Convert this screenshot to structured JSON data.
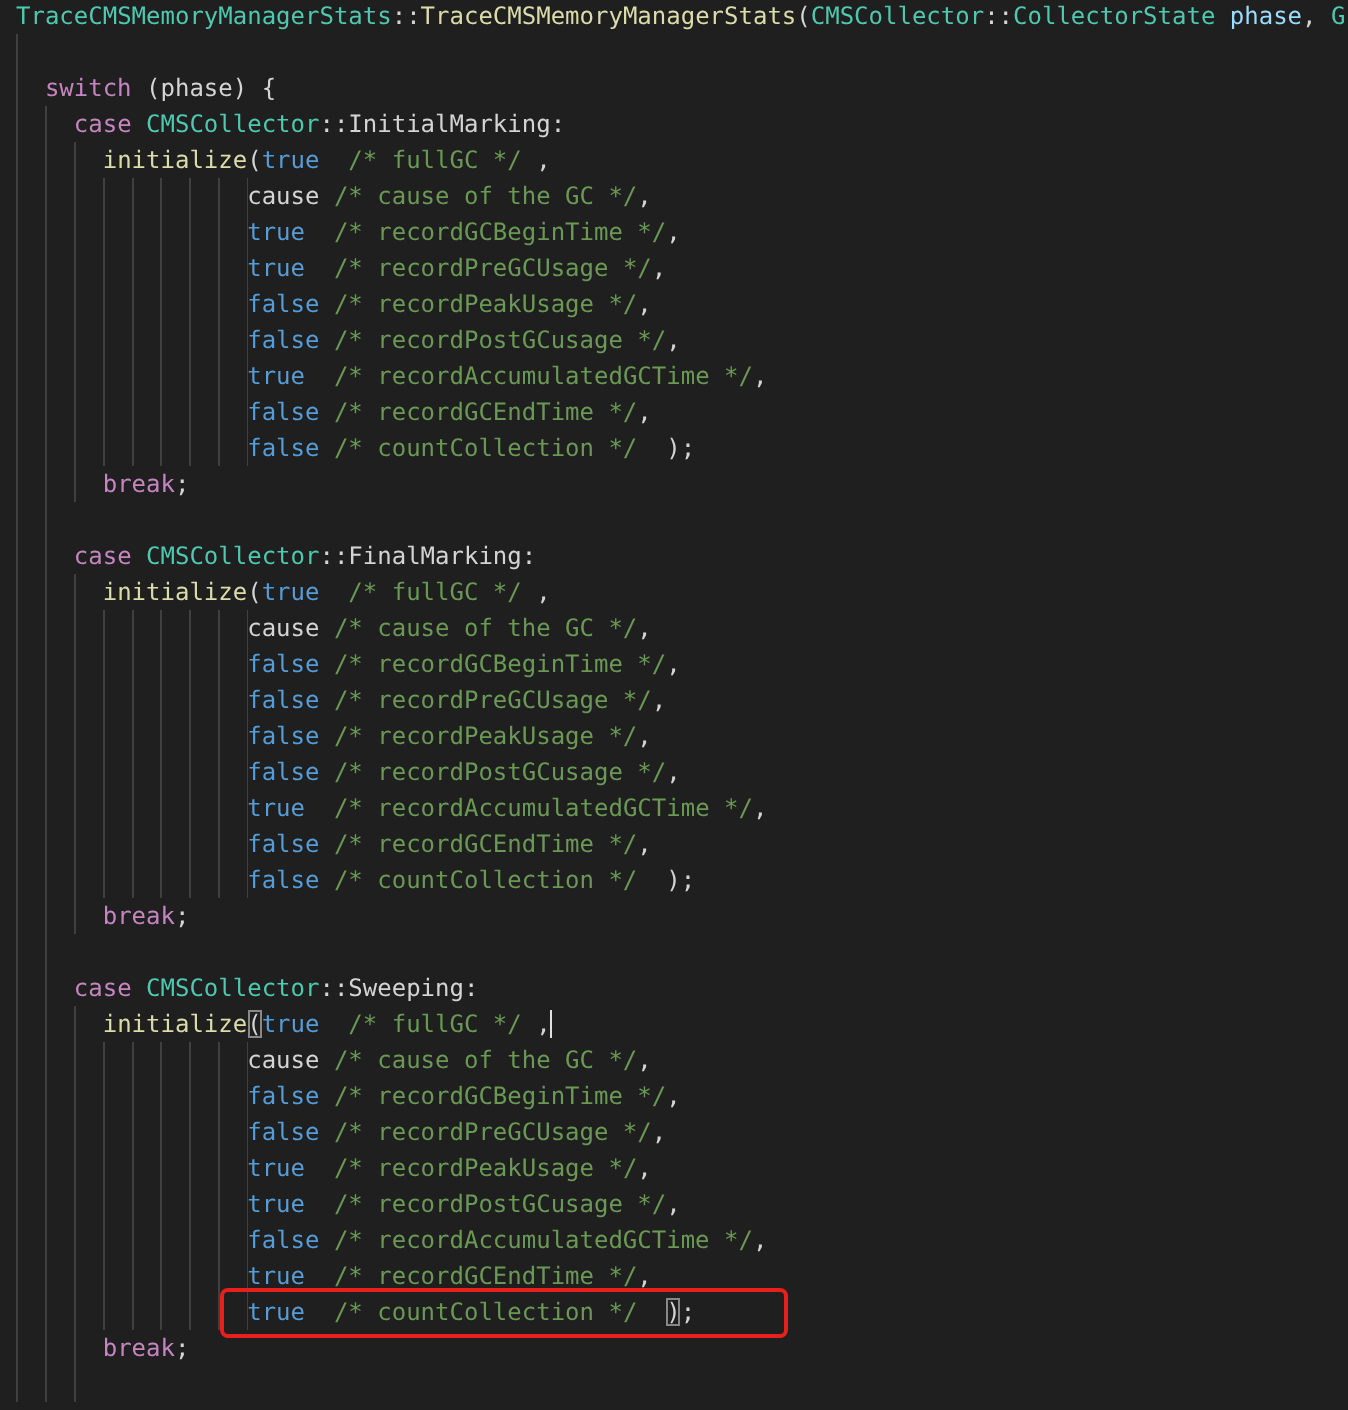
{
  "editor": {
    "lines": [
      {
        "kind": "code",
        "tokens": [
          {
            "kind": "type",
            "text": "TraceCMSMemoryManagerStats"
          },
          {
            "kind": "plain",
            "text": "::"
          },
          {
            "kind": "function",
            "text": "TraceCMSMemoryManagerStats"
          },
          {
            "kind": "plain",
            "text": "("
          },
          {
            "kind": "type",
            "text": "CMSCollector"
          },
          {
            "kind": "plain",
            "text": "::"
          },
          {
            "kind": "type",
            "text": "CollectorState"
          },
          {
            "kind": "param",
            "text": " phase"
          },
          {
            "kind": "plain",
            "text": ", "
          },
          {
            "kind": "type",
            "text": "G"
          }
        ]
      },
      {
        "kind": "blank"
      },
      {
        "kind": "code",
        "tokens": [
          {
            "kind": "keyword",
            "text": "  switch"
          },
          {
            "kind": "plain",
            "text": " (phase) {"
          }
        ]
      },
      {
        "kind": "code",
        "tokens": [
          {
            "kind": "keyword",
            "text": "    case "
          },
          {
            "kind": "type",
            "text": "CMSCollector"
          },
          {
            "kind": "plain",
            "text": "::InitialMarking:"
          }
        ]
      },
      {
        "kind": "code",
        "tokens": [
          {
            "kind": "function",
            "text": "      initialize"
          },
          {
            "kind": "plain",
            "text": "("
          },
          {
            "kind": "constant",
            "text": "true"
          },
          {
            "kind": "comment",
            "text": "  /* fullGC */"
          },
          {
            "kind": "plain",
            "text": " ,"
          }
        ]
      },
      {
        "kind": "code",
        "tokens": [
          {
            "kind": "plain",
            "text": "                cause"
          },
          {
            "kind": "comment",
            "text": " /* cause of the GC */"
          },
          {
            "kind": "plain",
            "text": ","
          }
        ]
      },
      {
        "kind": "code",
        "tokens": [
          {
            "kind": "constant",
            "text": "                true"
          },
          {
            "kind": "comment",
            "text": "  /* recordGCBeginTime */"
          },
          {
            "kind": "plain",
            "text": ","
          }
        ]
      },
      {
        "kind": "code",
        "tokens": [
          {
            "kind": "constant",
            "text": "                true"
          },
          {
            "kind": "comment",
            "text": "  /* recordPreGCUsage */"
          },
          {
            "kind": "plain",
            "text": ","
          }
        ]
      },
      {
        "kind": "code",
        "tokens": [
          {
            "kind": "constant",
            "text": "                false"
          },
          {
            "kind": "comment",
            "text": " /* recordPeakUsage */"
          },
          {
            "kind": "plain",
            "text": ","
          }
        ]
      },
      {
        "kind": "code",
        "tokens": [
          {
            "kind": "constant",
            "text": "                false"
          },
          {
            "kind": "comment",
            "text": " /* recordPostGCusage */"
          },
          {
            "kind": "plain",
            "text": ","
          }
        ]
      },
      {
        "kind": "code",
        "tokens": [
          {
            "kind": "constant",
            "text": "                true"
          },
          {
            "kind": "comment",
            "text": "  /* recordAccumulatedGCTime */"
          },
          {
            "kind": "plain",
            "text": ","
          }
        ]
      },
      {
        "kind": "code",
        "tokens": [
          {
            "kind": "constant",
            "text": "                false"
          },
          {
            "kind": "comment",
            "text": " /* recordGCEndTime */"
          },
          {
            "kind": "plain",
            "text": ","
          }
        ]
      },
      {
        "kind": "code",
        "tokens": [
          {
            "kind": "constant",
            "text": "                false"
          },
          {
            "kind": "comment",
            "text": " /* countCollection */"
          },
          {
            "kind": "plain",
            "text": "  );"
          }
        ]
      },
      {
        "kind": "code",
        "tokens": [
          {
            "kind": "keyword",
            "text": "      break"
          },
          {
            "kind": "plain",
            "text": ";"
          }
        ]
      },
      {
        "kind": "blank"
      },
      {
        "kind": "code",
        "tokens": [
          {
            "kind": "keyword",
            "text": "    case "
          },
          {
            "kind": "type",
            "text": "CMSCollector"
          },
          {
            "kind": "plain",
            "text": "::FinalMarking:"
          }
        ]
      },
      {
        "kind": "code",
        "tokens": [
          {
            "kind": "function",
            "text": "      initialize"
          },
          {
            "kind": "plain",
            "text": "("
          },
          {
            "kind": "constant",
            "text": "true"
          },
          {
            "kind": "comment",
            "text": "  /* fullGC */"
          },
          {
            "kind": "plain",
            "text": " ,"
          }
        ]
      },
      {
        "kind": "code",
        "tokens": [
          {
            "kind": "plain",
            "text": "                cause"
          },
          {
            "kind": "comment",
            "text": " /* cause of the GC */"
          },
          {
            "kind": "plain",
            "text": ","
          }
        ]
      },
      {
        "kind": "code",
        "tokens": [
          {
            "kind": "constant",
            "text": "                false"
          },
          {
            "kind": "comment",
            "text": " /* recordGCBeginTime */"
          },
          {
            "kind": "plain",
            "text": ","
          }
        ]
      },
      {
        "kind": "code",
        "tokens": [
          {
            "kind": "constant",
            "text": "                false"
          },
          {
            "kind": "comment",
            "text": " /* recordPreGCUsage */"
          },
          {
            "kind": "plain",
            "text": ","
          }
        ]
      },
      {
        "kind": "code",
        "tokens": [
          {
            "kind": "constant",
            "text": "                false"
          },
          {
            "kind": "comment",
            "text": " /* recordPeakUsage */"
          },
          {
            "kind": "plain",
            "text": ","
          }
        ]
      },
      {
        "kind": "code",
        "tokens": [
          {
            "kind": "constant",
            "text": "                false"
          },
          {
            "kind": "comment",
            "text": " /* recordPostGCusage */"
          },
          {
            "kind": "plain",
            "text": ","
          }
        ]
      },
      {
        "kind": "code",
        "tokens": [
          {
            "kind": "constant",
            "text": "                true"
          },
          {
            "kind": "comment",
            "text": "  /* recordAccumulatedGCTime */"
          },
          {
            "kind": "plain",
            "text": ","
          }
        ]
      },
      {
        "kind": "code",
        "tokens": [
          {
            "kind": "constant",
            "text": "                false"
          },
          {
            "kind": "comment",
            "text": " /* recordGCEndTime */"
          },
          {
            "kind": "plain",
            "text": ","
          }
        ]
      },
      {
        "kind": "code",
        "tokens": [
          {
            "kind": "constant",
            "text": "                false"
          },
          {
            "kind": "comment",
            "text": " /* countCollection */"
          },
          {
            "kind": "plain",
            "text": "  );"
          }
        ]
      },
      {
        "kind": "code",
        "tokens": [
          {
            "kind": "keyword",
            "text": "      break"
          },
          {
            "kind": "plain",
            "text": ";"
          }
        ]
      },
      {
        "kind": "blank"
      },
      {
        "kind": "code",
        "tokens": [
          {
            "kind": "keyword",
            "text": "    case "
          },
          {
            "kind": "type",
            "text": "CMSCollector"
          },
          {
            "kind": "plain",
            "text": "::Sweeping:"
          }
        ]
      },
      {
        "kind": "code",
        "tokens": [
          {
            "kind": "function",
            "text": "      initialize"
          },
          {
            "kind": "plain",
            "text": "(",
            "bracket_match": true
          },
          {
            "kind": "constant",
            "text": "true"
          },
          {
            "kind": "comment",
            "text": "  /* fullGC */ "
          },
          {
            "kind": "plain",
            "text": ",",
            "cursor": true
          }
        ]
      },
      {
        "kind": "code",
        "tokens": [
          {
            "kind": "plain",
            "text": "                cause"
          },
          {
            "kind": "comment",
            "text": " /* cause of the GC */"
          },
          {
            "kind": "plain",
            "text": ","
          }
        ]
      },
      {
        "kind": "code",
        "tokens": [
          {
            "kind": "constant",
            "text": "                false"
          },
          {
            "kind": "comment",
            "text": " /* recordGCBeginTime */"
          },
          {
            "kind": "plain",
            "text": ","
          }
        ]
      },
      {
        "kind": "code",
        "tokens": [
          {
            "kind": "constant",
            "text": "                false"
          },
          {
            "kind": "comment",
            "text": " /* recordPreGCUsage */"
          },
          {
            "kind": "plain",
            "text": ","
          }
        ]
      },
      {
        "kind": "code",
        "tokens": [
          {
            "kind": "constant",
            "text": "                true"
          },
          {
            "kind": "comment",
            "text": "  /* recordPeakUsage */"
          },
          {
            "kind": "plain",
            "text": ","
          }
        ]
      },
      {
        "kind": "code",
        "tokens": [
          {
            "kind": "constant",
            "text": "                true"
          },
          {
            "kind": "comment",
            "text": "  /* recordPostGCusage */"
          },
          {
            "kind": "plain",
            "text": ","
          }
        ]
      },
      {
        "kind": "code",
        "tokens": [
          {
            "kind": "constant",
            "text": "                false"
          },
          {
            "kind": "comment",
            "text": " /* recordAccumulatedGCTime */"
          },
          {
            "kind": "plain",
            "text": ","
          }
        ]
      },
      {
        "kind": "code",
        "tokens": [
          {
            "kind": "constant",
            "text": "                true"
          },
          {
            "kind": "comment",
            "text": "  /* recordGCEndTime */"
          },
          {
            "kind": "plain",
            "text": ","
          }
        ]
      },
      {
        "kind": "code",
        "highlighted": true,
        "tokens": [
          {
            "kind": "constant",
            "text": "                true"
          },
          {
            "kind": "comment",
            "text": "  /* countCollection */  "
          },
          {
            "kind": "plain",
            "text": ")",
            "bracket_match": true
          },
          {
            "kind": "plain",
            "text": ";"
          }
        ]
      },
      {
        "kind": "code",
        "tokens": [
          {
            "kind": "keyword",
            "text": "      break"
          },
          {
            "kind": "plain",
            "text": ";"
          }
        ]
      },
      {
        "kind": "blank"
      }
    ]
  }
}
